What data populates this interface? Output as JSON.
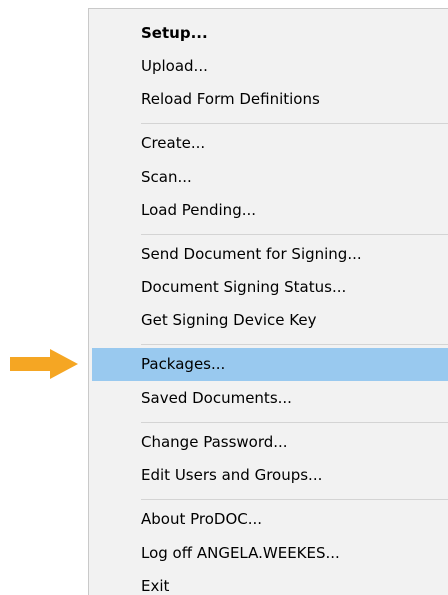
{
  "menu": {
    "items": [
      {
        "label": "Setup..."
      },
      {
        "label": "Upload..."
      },
      {
        "label": "Reload Form Definitions"
      },
      {
        "label": "Create..."
      },
      {
        "label": "Scan..."
      },
      {
        "label": "Load Pending..."
      },
      {
        "label": "Send Document for Signing..."
      },
      {
        "label": "Document Signing Status..."
      },
      {
        "label": "Get Signing Device Key"
      },
      {
        "label": "Packages...",
        "highlighted": true
      },
      {
        "label": "Saved Documents..."
      },
      {
        "label": "Change Password..."
      },
      {
        "label": "Edit Users and Groups..."
      },
      {
        "label": "About ProDOC..."
      },
      {
        "label": "Log off ANGELA.WEEKES..."
      },
      {
        "label": "Exit"
      }
    ]
  },
  "colors": {
    "menu_background": "#f2f2f2",
    "highlight": "#99c9ef",
    "arrow": "#f5a623"
  },
  "icons": {
    "pointer": "arrow-right-icon"
  }
}
